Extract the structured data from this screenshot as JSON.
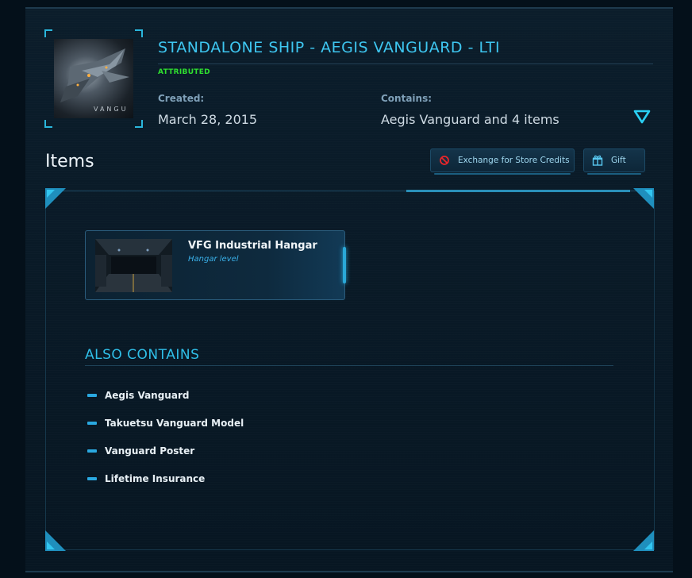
{
  "header": {
    "title": "STANDALONE SHIP - AEGIS VANGUARD - LTI",
    "status": "ATTRIBUTED",
    "thumbnail_caption": "VANGU",
    "created_label": "Created:",
    "created_value": "March 28, 2015",
    "contains_label": "Contains:",
    "contains_value": "Aegis Vanguard and 4 items",
    "toggle_icon": "chevron-down-icon"
  },
  "items_section": {
    "heading": "Items",
    "exchange_button": "Exchange for Store Credits",
    "gift_button": "Gift",
    "items": [
      {
        "title": "VFG Industrial Hangar",
        "subtitle": "Hangar level"
      }
    ]
  },
  "also_contains": {
    "heading": "ALSO CONTAINS",
    "items": [
      "Aegis Vanguard",
      "Takuetsu Vanguard Model",
      "Vanguard Poster",
      "Lifetime Insurance"
    ]
  },
  "colors": {
    "accent": "#3ec6f0",
    "status": "#2fe02f",
    "background": "#04101a"
  }
}
